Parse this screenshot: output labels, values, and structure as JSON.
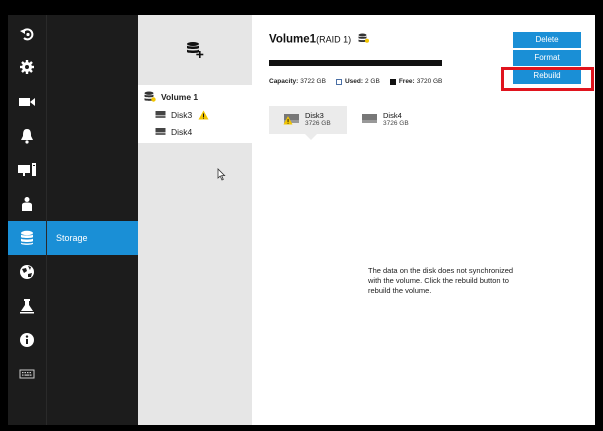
{
  "nav": {
    "rail": [
      {
        "icon": "rotate-back-icon"
      },
      {
        "icon": "gear-icon"
      },
      {
        "icon": "video-camera-icon"
      },
      {
        "icon": "bell-icon"
      },
      {
        "icon": "monitor-pc-icon"
      },
      {
        "icon": "user-icon"
      },
      {
        "icon": "database-icon",
        "active": true
      },
      {
        "icon": "globe-network-icon"
      },
      {
        "icon": "flask-lab-icon"
      },
      {
        "icon": "info-icon"
      },
      {
        "icon": "keyboard-icon"
      }
    ],
    "active_section_label": "Storage"
  },
  "tree": {
    "header_icon": "add-storage-icon",
    "volume_label": "Volume 1",
    "disks": [
      {
        "label": "Disk3",
        "warning": true
      },
      {
        "label": "Disk4",
        "warning": false
      }
    ]
  },
  "volume": {
    "name": "Volume1",
    "raid": "(RAID 1)",
    "capacity_label": "Capacity:",
    "capacity_value": "3722 GB",
    "used_label": "Used:",
    "used_value": "2 GB",
    "free_label": "Free:",
    "free_value": "3720 GB",
    "used_fraction": 0.0005
  },
  "actions": {
    "delete_label": "Delete",
    "format_label": "Format",
    "rebuild_label": "Rebuild"
  },
  "disk_tabs": [
    {
      "name": "Disk3",
      "size": "3726 GB",
      "selected": true,
      "warning": true
    },
    {
      "name": "Disk4",
      "size": "3726 GB",
      "selected": false,
      "warning": false
    }
  ],
  "message": "The data on the disk does not synchronized with the volume. Click the rebuild button to rebuild the volume.",
  "colors": {
    "accent": "#1a8fd6",
    "highlight": "#e0141e",
    "warning": "#f2c500"
  }
}
